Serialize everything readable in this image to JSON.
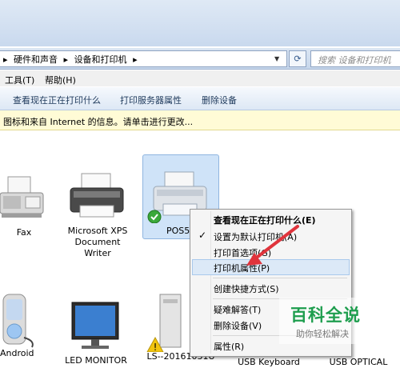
{
  "address": {
    "path": [
      "硬件和声音",
      "设备和打印机"
    ],
    "search_placeholder": "搜索 设备和打印机",
    "refresh_icon": "refresh-icon"
  },
  "menu": {
    "tools": "工具(T)",
    "help": "帮助(H)"
  },
  "toolbar": {
    "see_printing": "查看现在正在打印什么",
    "server_props": "打印服务器属性",
    "remove_device": "删除设备"
  },
  "infobar": {
    "text": "图标和来自 Internet 的信息。请单击进行更改..."
  },
  "devices": {
    "fax": "Fax",
    "xps_1": "Microsoft XPS",
    "xps_2": "Document",
    "xps_3": "Writer",
    "pos": "POS5",
    "android": "Android",
    "led": "LED MONITOR",
    "ls": "LS--20161031U",
    "usb_keyboard": "USB Keyboard",
    "usb_optical": "USB OPTICAL"
  },
  "context_menu": {
    "items": [
      "查看现在正在打印什么(E)",
      "设置为默认打印机(A)",
      "打印首选项(G)",
      "打印机属性(P)",
      "创建快捷方式(S)",
      "疑难解答(T)",
      "删除设备(V)",
      "属性(R)"
    ]
  },
  "watermark": {
    "title": "百科全说",
    "subtitle": "助你轻松解决"
  },
  "colors": {
    "highlight": "#dce9f7",
    "selected": "#cfe3f8",
    "arrow": "#e0343c",
    "brand": "#1e9e4e"
  }
}
